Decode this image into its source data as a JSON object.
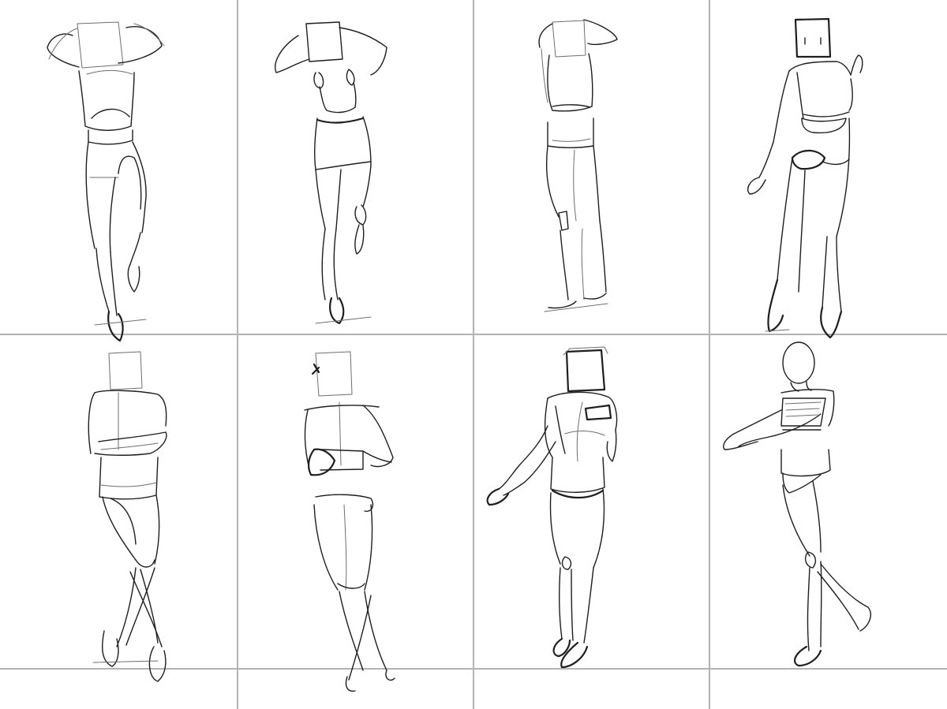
{
  "sheet": {
    "description_layout": "gesture-sketch-grid",
    "columns": 4,
    "rows_full": 2,
    "panels": [
      {
        "pose": "arms-up-back-view-leg-raised",
        "icon": "figure-sketch-icon"
      },
      {
        "pose": "arms-up-back-view-stepping",
        "icon": "figure-sketch-icon"
      },
      {
        "pose": "arms-up-side-standing",
        "icon": "figure-sketch-icon"
      },
      {
        "pose": "back-view-arm-out",
        "icon": "figure-sketch-icon"
      },
      {
        "pose": "arms-crossed-legs-crossed",
        "icon": "figure-sketch-icon"
      },
      {
        "pose": "arms-folded-legs-crossed",
        "icon": "figure-sketch-icon"
      },
      {
        "pose": "arm-extended-walking",
        "icon": "figure-sketch-icon"
      },
      {
        "pose": "arms-reaching-forward-back-view",
        "icon": "figure-sketch-icon"
      }
    ],
    "colors": {
      "background": "#ffffff",
      "grid_line": "#b3b3b3",
      "stroke": "#1e1e1e"
    }
  }
}
